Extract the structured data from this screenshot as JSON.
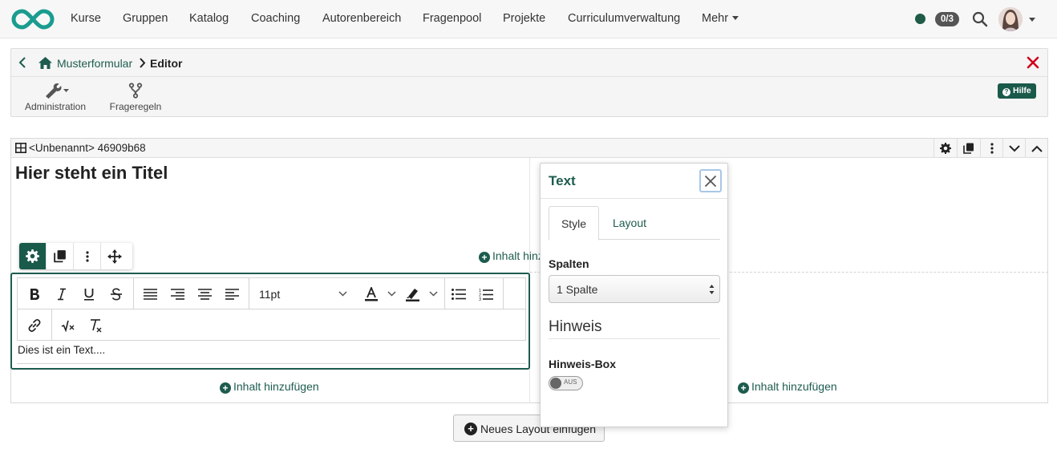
{
  "nav": {
    "items": [
      {
        "id": "kurse",
        "label": "Kurse"
      },
      {
        "id": "gruppen",
        "label": "Gruppen"
      },
      {
        "id": "katalog",
        "label": "Katalog"
      },
      {
        "id": "coaching",
        "label": "Coaching"
      },
      {
        "id": "autorenbereich",
        "label": "Autorenbereich"
      },
      {
        "id": "fragenpool",
        "label": "Fragenpool"
      },
      {
        "id": "projekte",
        "label": "Projekte"
      },
      {
        "id": "curriculumverwaltung",
        "label": "Curriculumverwaltung"
      }
    ],
    "more_label": "Mehr",
    "notification_count": "0/3",
    "status_color": "#1f5b46"
  },
  "breadcrumb": {
    "link": "Musterformular",
    "current": "Editor"
  },
  "toolbar": {
    "administration_label": "Administration",
    "frageregeln_label": "Frageregeln",
    "help_label": "Hilfe"
  },
  "layout": {
    "name": "<Unbenannt> 46909b68",
    "heading": "Hier steht ein Titel",
    "add_content_label": "Inhalt hinzufügen",
    "add_content_label_truncated": "Inhalt hinzu"
  },
  "editor": {
    "font_size": "11pt",
    "text": "Dies ist ein Text...."
  },
  "new_layout_label": "Neues Layout einfügen",
  "popup": {
    "title": "Text",
    "tabs": [
      {
        "id": "style",
        "label": "Style"
      },
      {
        "id": "layout",
        "label": "Layout"
      }
    ],
    "spalten_label": "Spalten",
    "spalten_value": "1 Spalte",
    "hinweis_heading": "Hinweis",
    "hinweis_box_label": "Hinweis-Box",
    "toggle_label": "AUS"
  },
  "colors": {
    "brand": "#1d5c4f",
    "close_red": "#d0021b"
  }
}
